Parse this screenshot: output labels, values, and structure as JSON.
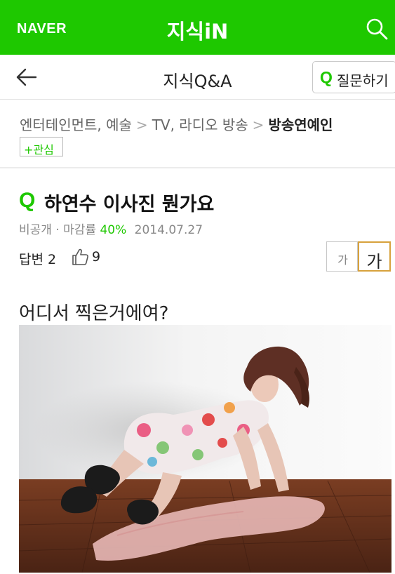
{
  "header": {
    "brand": "NAVER",
    "title": "지식iN",
    "search_icon": "search-icon",
    "background": "#1ec800"
  },
  "subheader": {
    "back_icon": "arrow-left-icon",
    "title": "지식Q&A",
    "ask_icon_letter": "Q",
    "ask_label": "질문하기"
  },
  "breadcrumb": {
    "items": [
      "엔터테인먼트, 예술",
      "TV, 라디오 방송",
      "방송연예인"
    ],
    "separator": ">",
    "follow_label": "+관심"
  },
  "question": {
    "icon_letter": "Q",
    "title": "하연수 이사진 뭔가요",
    "visibility": "비공개",
    "dot": "·",
    "close_rate_label": "마감률",
    "close_rate": "40%",
    "date": "2014.07.27",
    "answers_label": "답변 2",
    "likes": "9",
    "body": "어디서 찍은거에여?"
  },
  "font_size": {
    "small_label": "가",
    "large_label": "가",
    "selected": "large"
  },
  "colors": {
    "accent": "#1ec800",
    "selected_border": "#d7a13c"
  }
}
